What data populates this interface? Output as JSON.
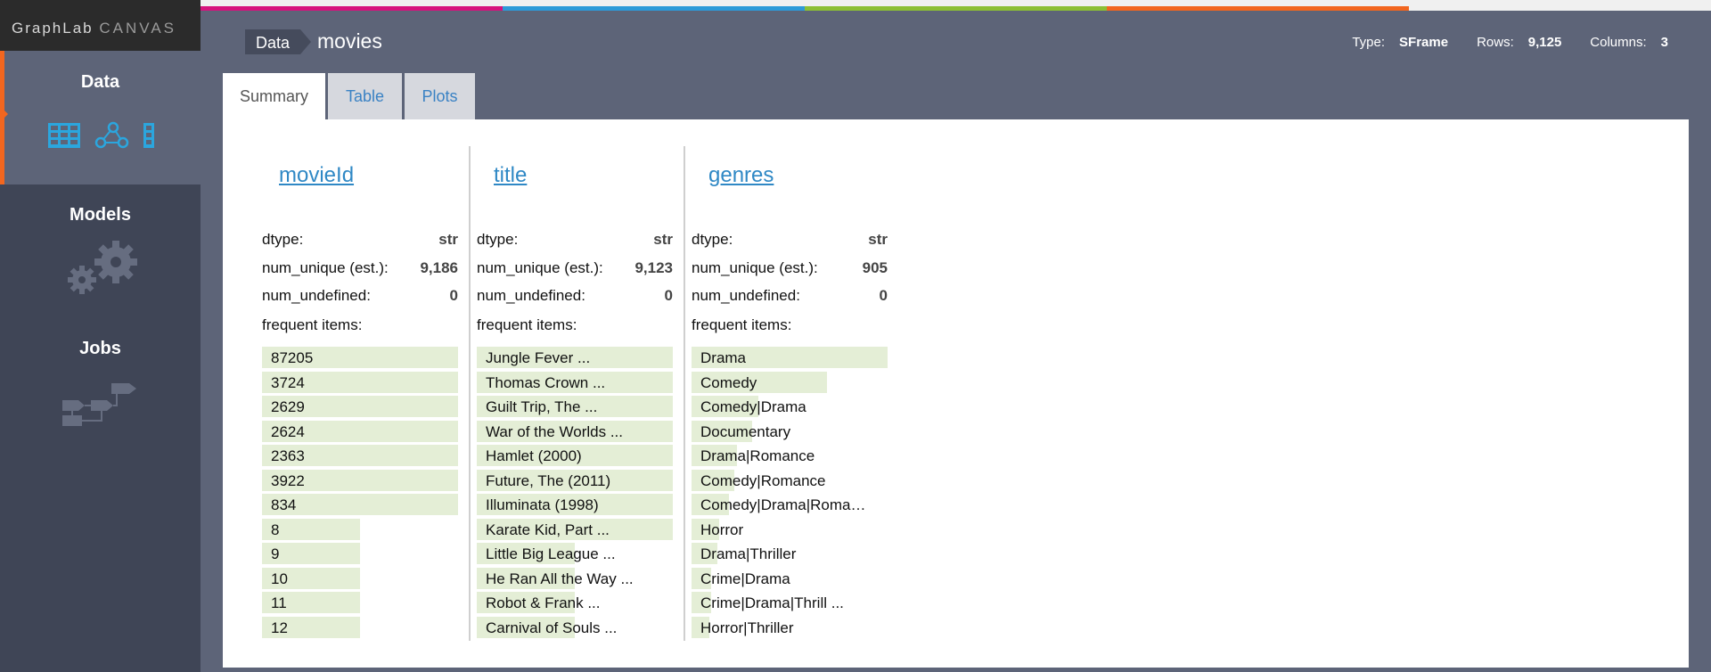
{
  "app": {
    "logo_main": "GraphLab",
    "logo_sub": "CANVAS"
  },
  "colors": {
    "accent": "#f2661f",
    "strip": [
      "#d6137d",
      "#2d9ad8",
      "#8cbf34",
      "#f2661f"
    ],
    "bar": "#e4eed6",
    "link": "#2f88c5"
  },
  "sidebar": {
    "data": {
      "label": "Data",
      "icons": [
        "table-icon",
        "graph-icon",
        "column-icon"
      ]
    },
    "models": {
      "label": "Models",
      "icon": "gears-icon"
    },
    "jobs": {
      "label": "Jobs",
      "icon": "flow-icon"
    }
  },
  "header": {
    "breadcrumb": "Data",
    "title": "movies",
    "type_label": "Type:",
    "type_value": "SFrame",
    "rows_label": "Rows:",
    "rows_value": "9,125",
    "cols_label": "Columns:",
    "cols_value": "3"
  },
  "tabs": [
    {
      "label": "Summary"
    },
    {
      "label": "Table"
    },
    {
      "label": "Plots"
    }
  ],
  "columns": [
    {
      "name": "movieId",
      "dtype_label": "dtype:",
      "dtype": "str",
      "unique_label": "num_unique (est.):",
      "unique": "9,186",
      "undefined_label": "num_undefined:",
      "undefined": "0",
      "freq_label": "frequent items:",
      "items": [
        {
          "label": "87205",
          "fraction": 1.0
        },
        {
          "label": "3724",
          "fraction": 1.0
        },
        {
          "label": "2629",
          "fraction": 1.0
        },
        {
          "label": "2624",
          "fraction": 1.0
        },
        {
          "label": "2363",
          "fraction": 1.0
        },
        {
          "label": "3922",
          "fraction": 1.0
        },
        {
          "label": "834",
          "fraction": 1.0
        },
        {
          "label": "8",
          "fraction": 0.5
        },
        {
          "label": "9",
          "fraction": 0.5
        },
        {
          "label": "10",
          "fraction": 0.5
        },
        {
          "label": "11",
          "fraction": 0.5
        },
        {
          "label": "12",
          "fraction": 0.5
        }
      ]
    },
    {
      "name": "title",
      "dtype_label": "dtype:",
      "dtype": "str",
      "unique_label": "num_unique (est.):",
      "unique": "9,123",
      "undefined_label": "num_undefined:",
      "undefined": "0",
      "freq_label": "frequent items:",
      "items": [
        {
          "label": "Jungle Fever ...",
          "fraction": 1.0
        },
        {
          "label": "Thomas Crown ...",
          "fraction": 1.0
        },
        {
          "label": "Guilt Trip, The ...",
          "fraction": 1.0
        },
        {
          "label": "War of the Worlds ...",
          "fraction": 1.0
        },
        {
          "label": "Hamlet (2000)",
          "fraction": 1.0
        },
        {
          "label": "Future, The (2011)",
          "fraction": 1.0
        },
        {
          "label": "Illuminata (1998)",
          "fraction": 1.0
        },
        {
          "label": "Karate Kid, Part ...",
          "fraction": 1.0
        },
        {
          "label": "Little Big League ...",
          "fraction": 0.5
        },
        {
          "label": "He Ran All the Way ...",
          "fraction": 0.5
        },
        {
          "label": "Robot & Frank ...",
          "fraction": 0.5
        },
        {
          "label": "Carnival of Souls ...",
          "fraction": 0.5
        }
      ]
    },
    {
      "name": "genres",
      "dtype_label": "dtype:",
      "dtype": "str",
      "unique_label": "num_unique (est.):",
      "unique": "905",
      "undefined_label": "num_undefined:",
      "undefined": "0",
      "freq_label": "frequent items:",
      "items": [
        {
          "label": "Drama",
          "fraction": 1.0
        },
        {
          "label": "Comedy",
          "fraction": 0.69
        },
        {
          "label": "Comedy|Drama",
          "fraction": 0.34
        },
        {
          "label": "Documentary",
          "fraction": 0.31
        },
        {
          "label": "Drama|Romance",
          "fraction": 0.23
        },
        {
          "label": "Comedy|Romance",
          "fraction": 0.22
        },
        {
          "label": "Comedy|Drama|Roma…",
          "fraction": 0.19
        },
        {
          "label": "Horror",
          "fraction": 0.14
        },
        {
          "label": "Drama|Thriller",
          "fraction": 0.13
        },
        {
          "label": "Crime|Drama",
          "fraction": 0.1
        },
        {
          "label": "Crime|Drama|Thrill ...",
          "fraction": 0.1
        },
        {
          "label": "Horror|Thriller",
          "fraction": 0.09
        }
      ]
    }
  ]
}
